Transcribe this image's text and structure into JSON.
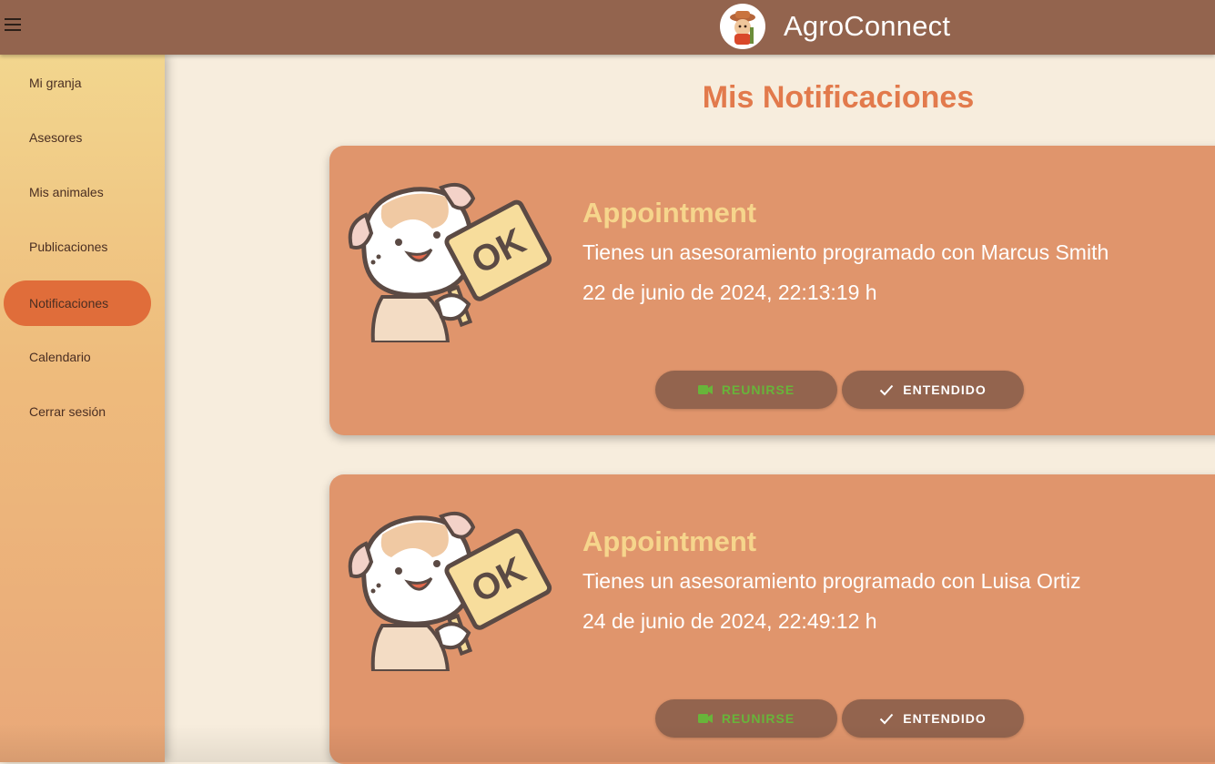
{
  "app": {
    "name": "AgroConnect"
  },
  "sidebar": {
    "items": [
      {
        "label": "Mi granja",
        "active": false
      },
      {
        "label": "Asesores",
        "active": false
      },
      {
        "label": "Mis animales",
        "active": false
      },
      {
        "label": "Publicaciones",
        "active": false
      },
      {
        "label": "Notificaciones",
        "active": true
      },
      {
        "label": "Calendario",
        "active": false
      },
      {
        "label": "Cerrar sesión",
        "active": false
      }
    ]
  },
  "page": {
    "title": "Mis Notificaciones"
  },
  "notifications": [
    {
      "title": "Appointment",
      "text": "Tienes un asesoramiento programado con Marcus Smith",
      "date": "22 de junio de 2024, 22:13:19 h",
      "meet_label": "REUNIRSE",
      "ack_label": "ENTENDIDO",
      "sign_text": "OK"
    },
    {
      "title": "Appointment",
      "text": "Tienes un asesoramiento programado con Luisa Ortiz",
      "date": "24 de junio de 2024, 22:49:12 h",
      "meet_label": "REUNIRSE",
      "ack_label": "ENTENDIDO",
      "sign_text": "OK"
    }
  ],
  "icons": {
    "menu": "hamburger-icon",
    "logo": "farmer-logo-icon",
    "meet": "video-camera-icon",
    "ack": "check-icon"
  },
  "colors": {
    "topbar": "#93644e",
    "accent": "#e06d3a",
    "card": "#e0956c",
    "title": "#e27a4c",
    "card_title": "#f6d58c",
    "meet_text": "#68b43a"
  }
}
